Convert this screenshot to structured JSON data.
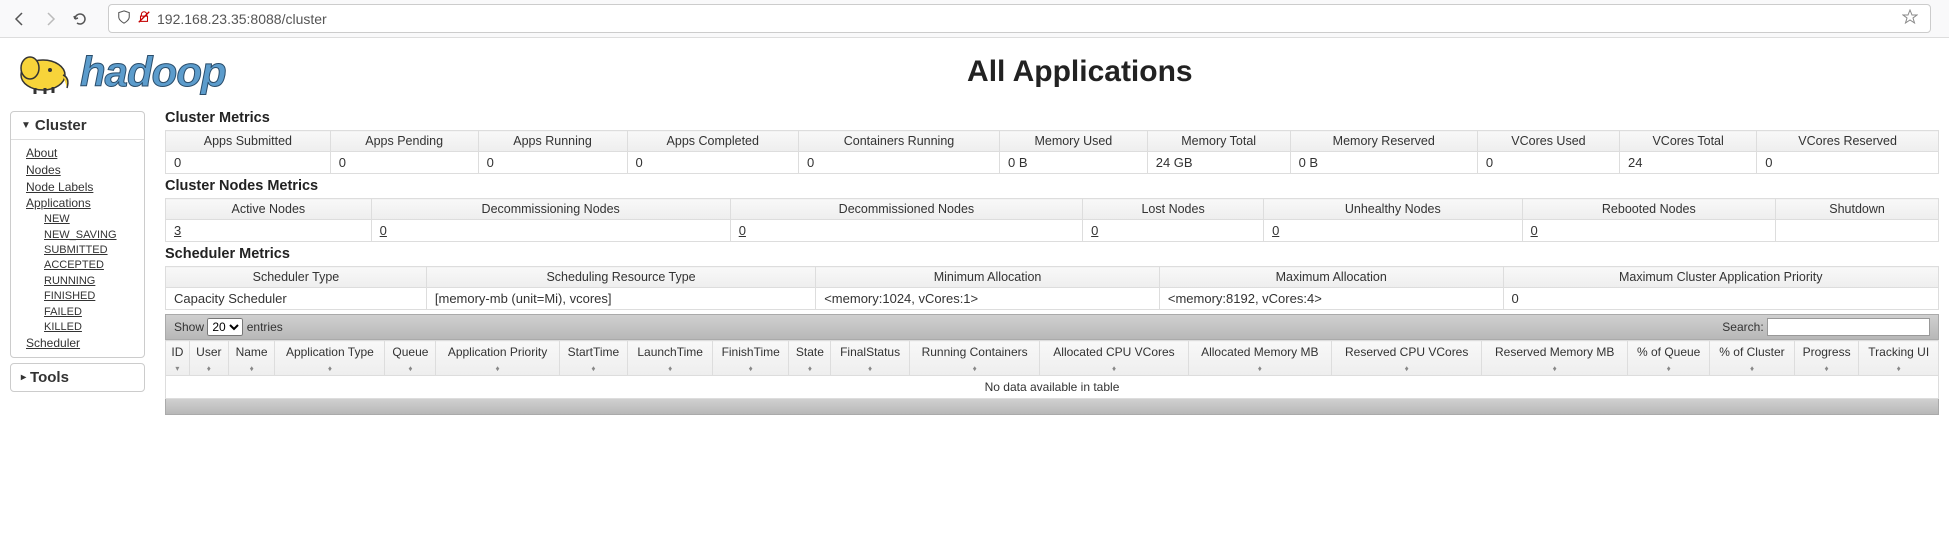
{
  "browser": {
    "url": "192.168.23.35:8088/cluster"
  },
  "header": {
    "logo_text": "hadoop",
    "title": "All Applications"
  },
  "sidebar": {
    "cluster_title": "Cluster",
    "tools_title": "Tools",
    "links": {
      "about": "About",
      "nodes": "Nodes",
      "node_labels": "Node Labels",
      "applications": "Applications",
      "scheduler": "Scheduler"
    },
    "app_states": {
      "new": "NEW",
      "new_saving": "NEW_SAVING",
      "submitted": "SUBMITTED",
      "accepted": "ACCEPTED",
      "running": "RUNNING",
      "finished": "FINISHED",
      "failed": "FAILED",
      "killed": "KILLED"
    }
  },
  "sections": {
    "cluster_metrics": "Cluster Metrics",
    "cluster_nodes_metrics": "Cluster Nodes Metrics",
    "scheduler_metrics": "Scheduler Metrics"
  },
  "cluster_metrics": {
    "headers": {
      "apps_submitted": "Apps Submitted",
      "apps_pending": "Apps Pending",
      "apps_running": "Apps Running",
      "apps_completed": "Apps Completed",
      "containers_running": "Containers Running",
      "memory_used": "Memory Used",
      "memory_total": "Memory Total",
      "memory_reserved": "Memory Reserved",
      "vcores_used": "VCores Used",
      "vcores_total": "VCores Total",
      "vcores_reserved": "VCores Reserved"
    },
    "values": {
      "apps_submitted": "0",
      "apps_pending": "0",
      "apps_running": "0",
      "apps_completed": "0",
      "containers_running": "0",
      "memory_used": "0 B",
      "memory_total": "24 GB",
      "memory_reserved": "0 B",
      "vcores_used": "0",
      "vcores_total": "24",
      "vcores_reserved": "0"
    }
  },
  "nodes_metrics": {
    "headers": {
      "active": "Active Nodes",
      "decommissioning": "Decommissioning Nodes",
      "decommissioned": "Decommissioned Nodes",
      "lost": "Lost Nodes",
      "unhealthy": "Unhealthy Nodes",
      "rebooted": "Rebooted Nodes",
      "shutdown": "Shutdown"
    },
    "values": {
      "active": "3",
      "decommissioning": "0",
      "decommissioned": "0",
      "lost": "0",
      "unhealthy": "0",
      "rebooted": "0",
      "shutdown": ""
    }
  },
  "scheduler_metrics": {
    "headers": {
      "type": "Scheduler Type",
      "resource_type": "Scheduling Resource Type",
      "min_alloc": "Minimum Allocation",
      "max_alloc": "Maximum Allocation",
      "max_priority": "Maximum Cluster Application Priority"
    },
    "values": {
      "type": "Capacity Scheduler",
      "resource_type": "[memory-mb (unit=Mi), vcores]",
      "min_alloc": "<memory:1024, vCores:1>",
      "max_alloc": "<memory:8192, vCores:4>",
      "max_priority": "0"
    }
  },
  "datatable": {
    "show_label": "Show",
    "entries_label": "entries",
    "page_size": "20",
    "search_label": "Search:",
    "no_data": "No data available in table",
    "headers": {
      "id": "ID",
      "user": "User",
      "name": "Name",
      "app_type": "Application Type",
      "queue": "Queue",
      "app_priority": "Application Priority",
      "start_time": "StartTime",
      "launch_time": "LaunchTime",
      "finish_time": "FinishTime",
      "state": "State",
      "final_status": "FinalStatus",
      "running_containers": "Running Containers",
      "alloc_cpu": "Allocated CPU VCores",
      "alloc_mem": "Allocated Memory MB",
      "reserved_cpu": "Reserved CPU VCores",
      "reserved_mem": "Reserved Memory MB",
      "pct_queue": "% of Queue",
      "pct_cluster": "% of Cluster",
      "progress": "Progress",
      "tracking_ui": "Tracking UI"
    }
  }
}
